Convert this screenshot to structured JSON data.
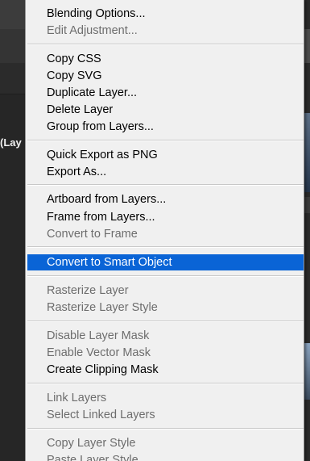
{
  "background": {
    "document_tab_fragment": "(Lay"
  },
  "context_menu": {
    "items": [
      {
        "label": "Blending Options...",
        "enabled": true
      },
      {
        "label": "Edit Adjustment...",
        "enabled": false
      },
      {
        "label": "Copy CSS",
        "enabled": true
      },
      {
        "label": "Copy SVG",
        "enabled": true
      },
      {
        "label": "Duplicate Layer...",
        "enabled": true
      },
      {
        "label": "Delete Layer",
        "enabled": true
      },
      {
        "label": "Group from Layers...",
        "enabled": true
      },
      {
        "label": "Quick Export as PNG",
        "enabled": true
      },
      {
        "label": "Export As...",
        "enabled": true
      },
      {
        "label": "Artboard from Layers...",
        "enabled": true
      },
      {
        "label": "Frame from Layers...",
        "enabled": true
      },
      {
        "label": "Convert to Frame",
        "enabled": false
      },
      {
        "label": "Convert to Smart Object",
        "enabled": true,
        "selected": true
      },
      {
        "label": "Rasterize Layer",
        "enabled": false
      },
      {
        "label": "Rasterize Layer Style",
        "enabled": false
      },
      {
        "label": "Disable Layer Mask",
        "enabled": false
      },
      {
        "label": "Enable Vector Mask",
        "enabled": false
      },
      {
        "label": "Create Clipping Mask",
        "enabled": true
      },
      {
        "label": "Link Layers",
        "enabled": false
      },
      {
        "label": "Select Linked Layers",
        "enabled": false
      },
      {
        "label": "Copy Layer Style",
        "enabled": false
      },
      {
        "label": "Paste Layer Style",
        "enabled": false
      }
    ]
  },
  "colors": {
    "selection": "#0a64d6",
    "menu_background": "#f0f0f0",
    "disabled_text": "#6d6d6d"
  }
}
